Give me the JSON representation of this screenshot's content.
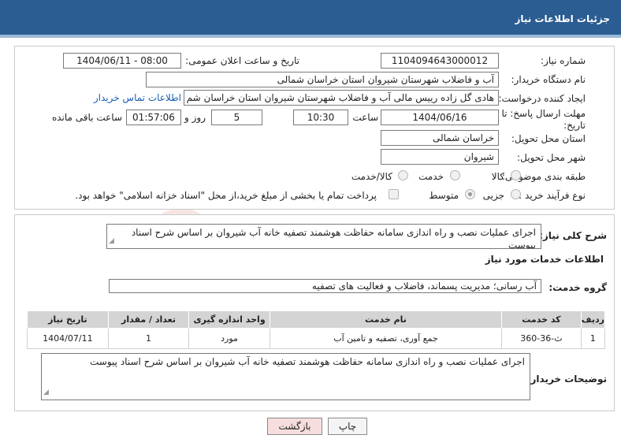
{
  "header": {
    "title": "جزئیات اطلاعات نیاز"
  },
  "form": {
    "need_number_label": "شماره نیاز:",
    "need_number": "1104094643000012",
    "announce_label": "تاریخ و ساعت اعلان عمومی:",
    "announce_value": "1404/06/11 - 08:00",
    "buyer_org_label": "نام دستگاه خریدار:",
    "buyer_org": "آب و فاضلاب شهرستان شیروان استان خراسان شمالی",
    "creator_label": "ایجاد کننده درخواست:",
    "creator": "هادی  گل زاده  رییس مالی آب و فاضلاب شهرستان شیروان استان خراسان شم",
    "contact_link": "اطلاعات تماس خریدار",
    "deadline_label_1": "مهلت ارسال پاسخ: تا",
    "deadline_label_2": "تاریخ:",
    "deadline_date": "1404/06/16",
    "time_label": "ساعت",
    "deadline_time": "10:30",
    "days_value": "5",
    "days_label": "روز و",
    "remaining_time": "01:57:06",
    "remaining_label": "ساعت باقی مانده",
    "province_label": "استان محل تحویل:",
    "province": "خراسان شمالی",
    "city_label": "شهر محل تحویل:",
    "city": "شیروان",
    "category_label": "طبقه بندی موضوعی:",
    "category_options": [
      "کالا",
      "خدمت",
      "کالا/خدمت"
    ],
    "category_selected": "خدمت",
    "process_label": "نوع فرآیند خرید :",
    "process_options": [
      "جزیی",
      "متوسط"
    ],
    "process_selected": "متوسط",
    "payment_note": "پرداخت تمام یا بخشی از مبلغ خرید،از محل \"اسناد خزانه اسلامی\" خواهد بود."
  },
  "summary": {
    "label": "شرح کلی نیاز:",
    "text": "اجرای عملیات نصب و راه اندازی سامانه حفاظت  هوشمند تصفیه خانه آب شیروان بر اساس شرح اسناد پیوست"
  },
  "services": {
    "section_title": "اطلاعات خدمات مورد نیاز",
    "group_label": "گروه خدمت:",
    "group_value": "آب رسانی؛ مدیریت پسماند، فاضلاب و فعالیت های تصفیه",
    "columns": [
      "ردیف",
      "کد خدمت",
      "نام خدمت",
      "واحد اندازه گیری",
      "تعداد / مقدار",
      "تاریخ نیاز"
    ],
    "rows": [
      {
        "row": "1",
        "code": "ث-36-360",
        "name": "جمع آوری، تصفیه و تامین آب",
        "unit": "مورد",
        "qty": "1",
        "date": "1404/07/11"
      }
    ]
  },
  "buyer_notes": {
    "label": "توضیحات خریدار:",
    "text": "اجرای عملیات نصب و راه اندازی سامانه حفاظت  هوشمند تصفیه خانه آب شیروان بر اساس شرح اسناد پیوست"
  },
  "buttons": {
    "print": "چاپ",
    "back": "بازگشت"
  },
  "watermark": "AriaTender.neT",
  "colors": {
    "header": "#2b5d93",
    "header_border": "#9bb8d8",
    "link": "#1a5fb4",
    "back_button": "#f7dede"
  }
}
